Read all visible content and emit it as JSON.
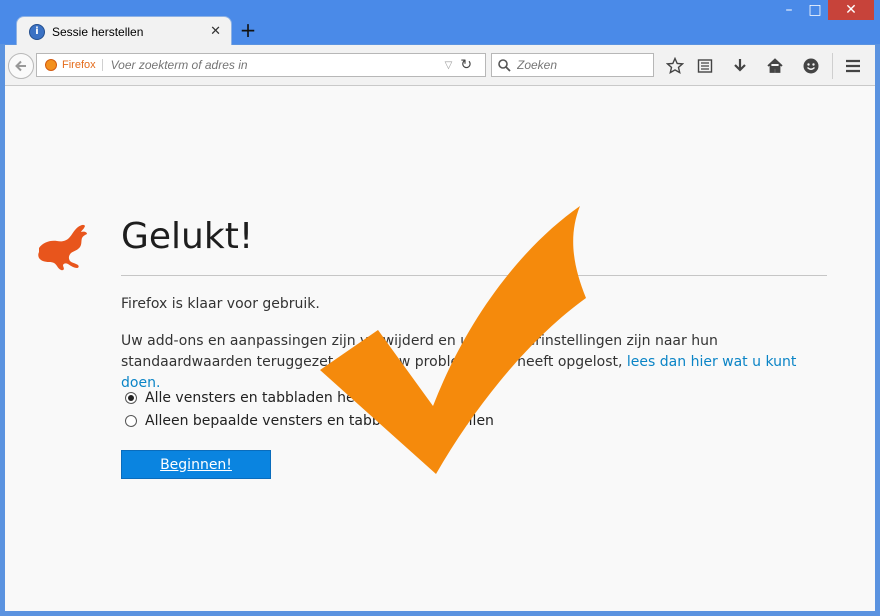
{
  "window": {
    "controls": {
      "minimize": "–",
      "maximize": "□",
      "close": "✕"
    }
  },
  "tab": {
    "title": "Sessie herstellen",
    "close": "✕",
    "new_tab": "+"
  },
  "toolbar": {
    "identity_label": "Firefox",
    "url_placeholder": "Voer zoekterm of adres in",
    "search_placeholder": "Zoeken",
    "icons": [
      "back-icon",
      "dropdown-icon",
      "reload-icon",
      "search-icon",
      "bookmark-star-icon",
      "reading-list-icon",
      "download-icon",
      "home-icon",
      "hello-icon",
      "menu-icon"
    ]
  },
  "page": {
    "heading": "Gelukt!",
    "intro": "Firefox is klaar voor gebruik.",
    "body_before_link": "Uw add-ons en aanpassingen zijn verwijderd en uw browserinstellingen zijn naar hun standaardwaarden teruggezet. Als dit uw probleem niet heeft opgelost, ",
    "body_link": "lees dan hier wat u kunt doen.",
    "options": [
      {
        "label": "Alle vensters en tabbladen herstellen",
        "checked": true
      },
      {
        "label": "Alleen bepaalde vensters en tabbladen herstellen",
        "checked": false
      }
    ],
    "button_label": "Beginnen!"
  },
  "colors": {
    "accent": "#0a84e0",
    "link": "#0a84c6",
    "checkmark": "#f58a0c",
    "fox": "#e8551c",
    "titlebar": "#4a8ae8"
  }
}
